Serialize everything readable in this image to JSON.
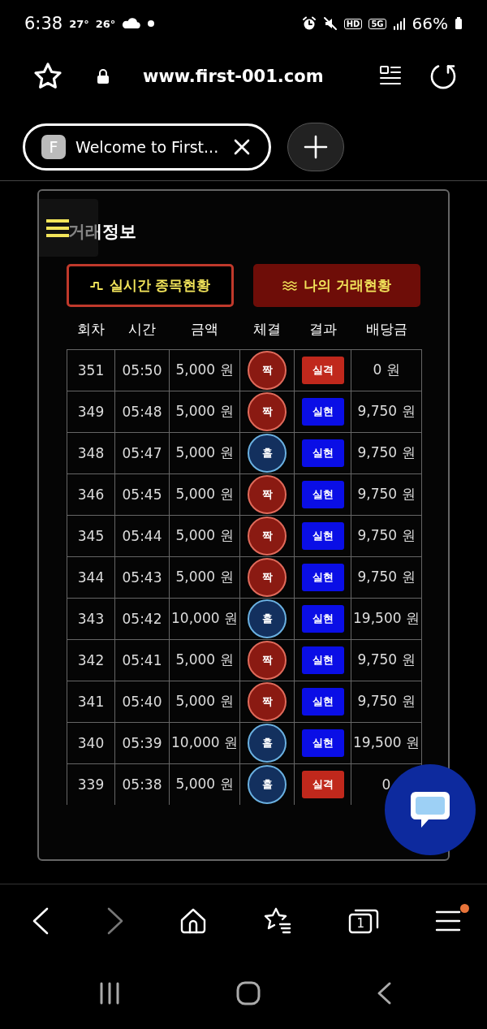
{
  "status_bar": {
    "time": "6:38",
    "temps": [
      "27°",
      "26°"
    ],
    "badges": [
      "HD",
      "5G"
    ],
    "battery": "66%"
  },
  "browser": {
    "url": "www.first-001.com",
    "tab": {
      "favicon": "F",
      "title": "Welcome to First..."
    }
  },
  "page": {
    "title": "거래정보",
    "buttons": [
      {
        "label": "실시간 종목현황",
        "selected": false
      },
      {
        "label": "나의 거래현황",
        "selected": true
      }
    ],
    "columns": [
      "회차",
      "시간",
      "금액",
      "체결",
      "결과",
      "배당금"
    ],
    "rows": [
      {
        "round": "351",
        "time": "05:50",
        "amount": "5,000 원",
        "pick": {
          "kind": "even",
          "label": "짝"
        },
        "result": {
          "kind": "fail",
          "label": "실격"
        },
        "payout": "0 원"
      },
      {
        "round": "349",
        "time": "05:48",
        "amount": "5,000 원",
        "pick": {
          "kind": "even",
          "label": "짝"
        },
        "result": {
          "kind": "win",
          "label": "실현"
        },
        "payout": "9,750 원"
      },
      {
        "round": "348",
        "time": "05:47",
        "amount": "5,000 원",
        "pick": {
          "kind": "odd",
          "label": "홀"
        },
        "result": {
          "kind": "win",
          "label": "실현"
        },
        "payout": "9,750 원"
      },
      {
        "round": "346",
        "time": "05:45",
        "amount": "5,000 원",
        "pick": {
          "kind": "even",
          "label": "짝"
        },
        "result": {
          "kind": "win",
          "label": "실현"
        },
        "payout": "9,750 원"
      },
      {
        "round": "345",
        "time": "05:44",
        "amount": "5,000 원",
        "pick": {
          "kind": "even",
          "label": "짝"
        },
        "result": {
          "kind": "win",
          "label": "실현"
        },
        "payout": "9,750 원"
      },
      {
        "round": "344",
        "time": "05:43",
        "amount": "5,000 원",
        "pick": {
          "kind": "even",
          "label": "짝"
        },
        "result": {
          "kind": "win",
          "label": "실현"
        },
        "payout": "9,750 원"
      },
      {
        "round": "343",
        "time": "05:42",
        "amount": "10,000 원",
        "pick": {
          "kind": "odd",
          "label": "홀"
        },
        "result": {
          "kind": "win",
          "label": "실현"
        },
        "payout": "19,500 원"
      },
      {
        "round": "342",
        "time": "05:41",
        "amount": "5,000 원",
        "pick": {
          "kind": "even",
          "label": "짝"
        },
        "result": {
          "kind": "win",
          "label": "실현"
        },
        "payout": "9,750 원"
      },
      {
        "round": "341",
        "time": "05:40",
        "amount": "5,000 원",
        "pick": {
          "kind": "even",
          "label": "짝"
        },
        "result": {
          "kind": "win",
          "label": "실현"
        },
        "payout": "9,750 원"
      },
      {
        "round": "340",
        "time": "05:39",
        "amount": "10,000 원",
        "pick": {
          "kind": "odd",
          "label": "홀"
        },
        "result": {
          "kind": "win",
          "label": "실현"
        },
        "payout": "19,500 원"
      },
      {
        "round": "339",
        "time": "05:38",
        "amount": "5,000 원",
        "pick": {
          "kind": "odd",
          "label": "홀"
        },
        "result": {
          "kind": "fail",
          "label": "실격"
        },
        "payout": "0"
      }
    ]
  },
  "bottom_bar": {
    "forward_disabled": true,
    "tab_count": "1",
    "menu_notification": true
  }
}
